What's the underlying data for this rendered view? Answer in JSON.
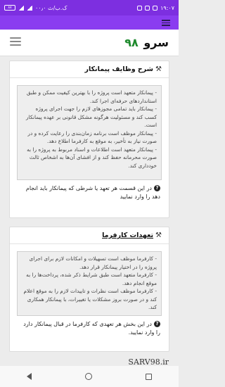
{
  "status_bar": {
    "time": "۱۹:۰۷",
    "battery": "۸۷",
    "carrier_text": "۰۰٫۰ ک.ب/ث"
  },
  "header": {
    "logo_text": "سرو",
    "logo_number": "۹۸"
  },
  "cards": [
    {
      "title": "شرح وظایف پیمانکار",
      "paragraphs": [
        "- پیمانکار متعهد است پروژه را با بهترین کیفیت ممکن و طبق استانداردهای حرفه‌ای اجرا کند.",
        "- پیمانکار باید تمامی مجوزهای لازم را جهت اجرای پروژه کسب کند و مسئولیت هرگونه مشکل قانونی بر عهده پیمانکار است.",
        "- پیمانکار موظف است برنامه زمان‌بندی را رعایت کرده و در صورت نیاز به تأخیر، به موقع به کارفرما اطلاع دهد.",
        "- پیمانکار متعهد است اطلاعات و اسناد مربوط به پروژه را به صورت محرمانه حفظ کند و از افشای آن‌ها به اشخاص ثالث خودداری کند."
      ],
      "note": "در این قسمت هر تعهد یا شرطی که پیمانکار باید انجام دهد را وارد نمایید"
    },
    {
      "title": "تعهدات کارفرما",
      "paragraphs": [
        "- کارفرما موظف است تسهیلات و امکانات لازم برای اجرای پروژه را در اختیار پیمانکار قرار دهد.",
        "- کارفرما متعهد است طبق شرایط ذکر شده، پرداخت‌ها را به موقع انجام دهد.",
        "- کارفرما موظف است نظرات و تاییدات لازم را به موقع اعلام کند و در صورت بروز مشکلات یا تغییرات، با پیمانکار همکاری کند."
      ],
      "note": "در این بخش هر تعهدی که کارفرما در قبال پیمانکار دارد را وارد نمایید."
    }
  ],
  "watermark": "SARV98.ir",
  "icons": {
    "card_icon": "hammer-icon",
    "note_icon": "question-circle-icon"
  }
}
